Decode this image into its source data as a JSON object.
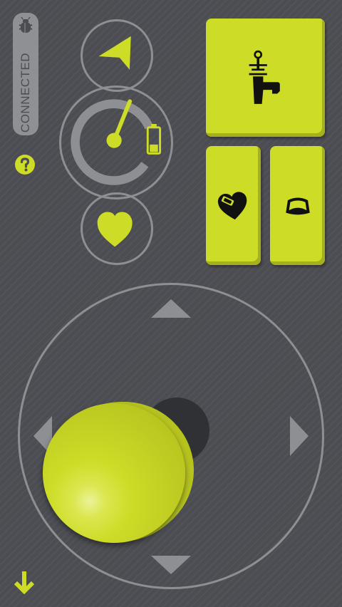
{
  "status": {
    "label": "CONNECTED"
  },
  "icons": {
    "bug": "bug-icon",
    "help": "question-icon",
    "down": "arrow-down-icon",
    "nav": "navigation-arrow-icon",
    "battery": "battery-icon",
    "heart": "heart-icon",
    "tool": "water-gun-icon",
    "heart_badge": "heart-badge-icon",
    "bowl": "bowl-icon"
  },
  "gauge": {
    "battery_level": 0.35
  },
  "colors": {
    "accent": "#cddc27",
    "background": "#4c4d52",
    "outline": "#8e8f93",
    "pill": "#8f9094"
  },
  "joystick": {
    "directions": [
      "up",
      "down",
      "left",
      "right"
    ]
  }
}
